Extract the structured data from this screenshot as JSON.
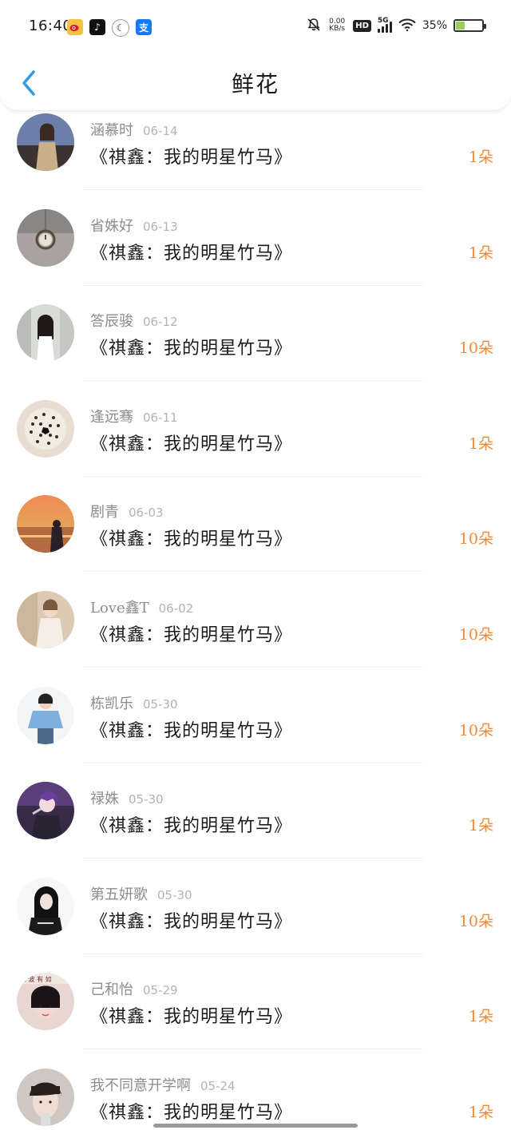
{
  "status_bar": {
    "time": "16:40",
    "net_speed": "0.00\nKB/s",
    "hd": "HD",
    "network": "5G",
    "battery_percent": "35%",
    "battery_level": 0.35,
    "battery_color": "#9acd5a",
    "app_icons": [
      "weibo-icon",
      "tiktok-icon",
      "moon-app-icon",
      "alipay-icon"
    ],
    "right_icons": [
      "bell-muted-icon",
      "net-speed",
      "hd-badge",
      "signal-icon",
      "wifi-icon",
      "battery-icon"
    ]
  },
  "header": {
    "title": "鲜花",
    "back_icon": "chevron-left-icon",
    "accent_color": "#2f9be3"
  },
  "colors": {
    "flower_count": "#ee8a3c",
    "username": "#8c8c8c",
    "date": "#b3b3b3",
    "title": "#1a1a1a"
  },
  "items": [
    {
      "user": "涵慕时",
      "date": "06-14",
      "book": "《祺鑫：我的明星竹马》",
      "count": "1朵"
    },
    {
      "user": "省姝好",
      "date": "06-13",
      "book": "《祺鑫：我的明星竹马》",
      "count": "1朵"
    },
    {
      "user": "答辰骏",
      "date": "06-12",
      "book": "《祺鑫：我的明星竹马》",
      "count": "10朵"
    },
    {
      "user": "逢远骞",
      "date": "06-11",
      "book": "《祺鑫：我的明星竹马》",
      "count": "1朵"
    },
    {
      "user": "剧青",
      "date": "06-03",
      "book": "《祺鑫：我的明星竹马》",
      "count": "10朵"
    },
    {
      "user": "Love鑫T",
      "date": "06-02",
      "book": "《祺鑫：我的明星竹马》",
      "count": "10朵"
    },
    {
      "user": "栋凯乐",
      "date": "05-30",
      "book": "《祺鑫：我的明星竹马》",
      "count": "10朵"
    },
    {
      "user": "禄姝",
      "date": "05-30",
      "book": "《祺鑫：我的明星竹马》",
      "count": "1朵"
    },
    {
      "user": "第五妍歌",
      "date": "05-30",
      "book": "《祺鑫：我的明星竹马》",
      "count": "10朵"
    },
    {
      "user": "己和怡",
      "date": "05-29",
      "book": "《祺鑫：我的明星竹马》",
      "count": "1朵"
    },
    {
      "user": "我不同意开学啊",
      "date": "05-24",
      "book": "《祺鑫：我的明星竹马》",
      "count": "1朵"
    }
  ]
}
